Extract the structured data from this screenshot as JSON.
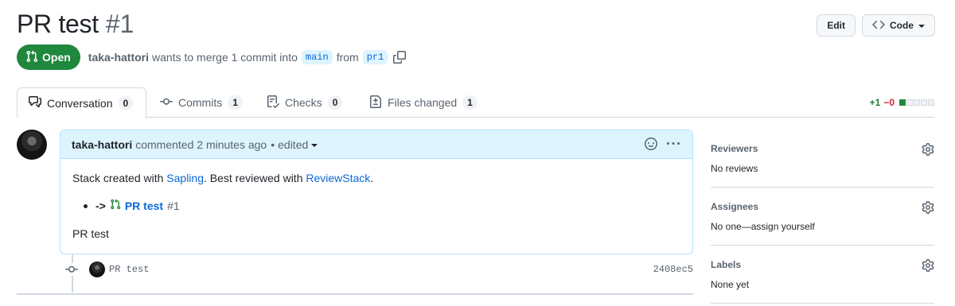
{
  "pr": {
    "title": "PR test",
    "number": "#1",
    "state": "Open",
    "author": "taka-hattori",
    "merge_text": "wants to merge 1 commit into",
    "base_branch": "main",
    "from_text": "from",
    "head_branch": "pr1"
  },
  "header_actions": {
    "edit_label": "Edit",
    "code_label": "Code"
  },
  "tabs": [
    {
      "label": "Conversation",
      "count": "0",
      "icon": "comment-discussion-icon"
    },
    {
      "label": "Commits",
      "count": "1",
      "icon": "git-commit-icon"
    },
    {
      "label": "Checks",
      "count": "0",
      "icon": "checklist-icon"
    },
    {
      "label": "Files changed",
      "count": "1",
      "icon": "file-diff-icon"
    }
  ],
  "diffstat": {
    "additions": "+1",
    "deletions": "−0",
    "add_blocks": 1,
    "total_blocks": 5
  },
  "comment": {
    "author": "taka-hattori",
    "meta": "commented 2 minutes ago",
    "separator": "•",
    "edited": "edited",
    "body_prefix": "Stack created with ",
    "sapling_link": "Sapling",
    "body_middle": ". Best reviewed with ",
    "reviewstack_link": "ReviewStack",
    "body_suffix": ".",
    "list_arrow": "->",
    "list_pr_title": "PR test",
    "list_pr_number": "#1",
    "footer_text": "PR test"
  },
  "commit": {
    "message": "PR test",
    "sha": "2408ec5"
  },
  "sidebar": {
    "reviewers": {
      "heading": "Reviewers",
      "value": "No reviews"
    },
    "assignees": {
      "heading": "Assignees",
      "value_prefix": "No one—",
      "value_link": "assign yourself"
    },
    "labels": {
      "heading": "Labels",
      "value": "None yet"
    }
  },
  "colors": {
    "open_green": "#1f883d",
    "link_blue": "#0969da",
    "comment_header_bg": "#ddf4ff",
    "addition_green": "#1a7f37",
    "deletion_red": "#d1242f"
  }
}
